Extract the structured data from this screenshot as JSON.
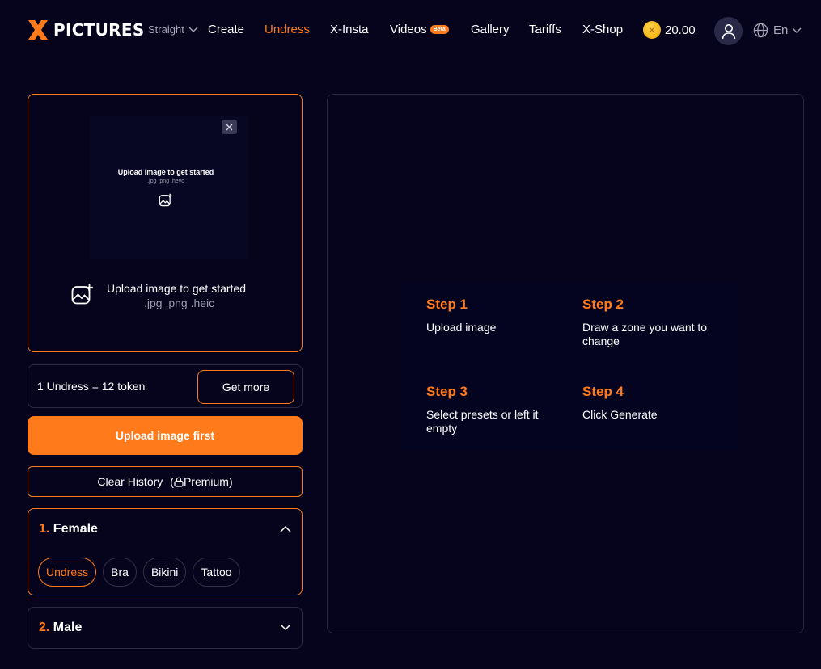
{
  "header": {
    "logo_text": "PICTURES",
    "mode": "Straight",
    "nav": [
      {
        "label": "Create",
        "active": false
      },
      {
        "label": "Undress",
        "active": true
      },
      {
        "label": "X-Insta",
        "active": false
      },
      {
        "label": "Videos",
        "active": false,
        "badge": "Beta"
      },
      {
        "label": "Gallery",
        "active": false
      },
      {
        "label": "Tariffs",
        "active": false
      },
      {
        "label": "X-Shop",
        "active": false
      }
    ],
    "coins": "20.00",
    "language": "En"
  },
  "upload": {
    "preview_title": "Upload image to get started",
    "preview_formats": ".jpg .png .hevc",
    "title": "Upload image to get started",
    "formats": ".jpg .png .heic"
  },
  "tokens": {
    "cost_text": "1 Undress = 12 token",
    "get_more": "Get more"
  },
  "actions": {
    "primary": "Upload image first",
    "clear_history": "Clear History",
    "premium": "Premium"
  },
  "presets": {
    "female": {
      "number": "1.",
      "title": "Female",
      "chips": [
        {
          "label": "Undress",
          "active": true
        },
        {
          "label": "Bra",
          "active": false
        },
        {
          "label": "Bikini",
          "active": false
        },
        {
          "label": "Tattoo",
          "active": false
        }
      ]
    },
    "male": {
      "number": "2.",
      "title": "Male"
    }
  },
  "steps": [
    {
      "title": "Step 1",
      "desc": "Upload image"
    },
    {
      "title": "Step 2",
      "desc": "Draw a zone you want to change"
    },
    {
      "title": "Step 3",
      "desc": "Select presets or left it empty"
    },
    {
      "title": "Step 4",
      "desc": "Click Generate"
    }
  ],
  "colors": {
    "accent": "#ff7a1a",
    "background": "#05041c",
    "border": "#262640"
  }
}
